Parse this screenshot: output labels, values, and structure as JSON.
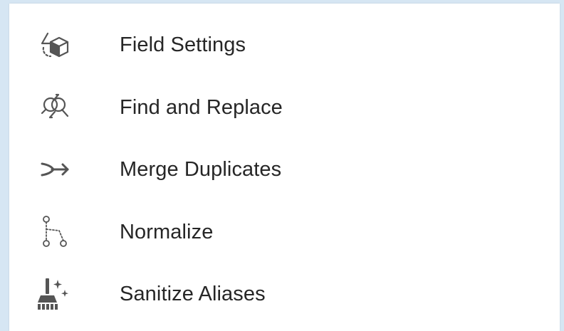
{
  "menu": {
    "items": [
      {
        "label": "Field Settings",
        "icon": "shapes-settings-icon"
      },
      {
        "label": "Find and Replace",
        "icon": "find-replace-icon"
      },
      {
        "label": "Merge Duplicates",
        "icon": "merge-arrow-icon"
      },
      {
        "label": "Normalize",
        "icon": "normalize-tree-icon"
      },
      {
        "label": "Sanitize Aliases",
        "icon": "broom-sparkle-icon"
      }
    ]
  },
  "colors": {
    "background": "#d6e6f3",
    "panel": "#ffffff",
    "text": "#262626",
    "icon": "#555555"
  }
}
